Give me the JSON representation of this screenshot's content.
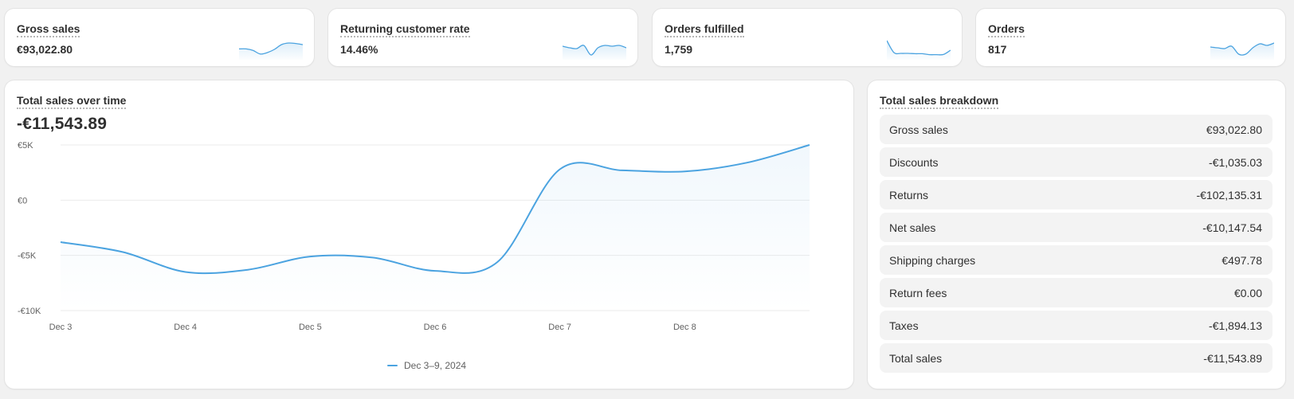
{
  "metrics": [
    {
      "title": "Gross sales",
      "value": "€93,022.80",
      "spark": [
        0.52,
        0.52,
        0.62,
        0.84,
        0.75,
        0.55,
        0.25,
        0.15,
        0.18,
        0.25
      ]
    },
    {
      "title": "Returning customer rate",
      "value": "14.46%",
      "spark": [
        0.35,
        0.45,
        0.5,
        0.3,
        0.9,
        0.45,
        0.3,
        0.35,
        0.3,
        0.45
      ]
    },
    {
      "title": "Orders fulfilled",
      "value": "1,759",
      "spark": [
        0.0,
        0.75,
        0.8,
        0.8,
        0.82,
        0.82,
        0.88,
        0.88,
        0.87,
        0.6
      ]
    },
    {
      "title": "Orders",
      "value": "817",
      "spark": [
        0.4,
        0.45,
        0.5,
        0.35,
        0.85,
        0.85,
        0.45,
        0.2,
        0.3,
        0.15
      ]
    }
  ],
  "chart": {
    "title": "Total sales over time",
    "total": "-€11,543.89",
    "legend": "Dec 3–9, 2024"
  },
  "chart_data": {
    "type": "area",
    "title": "Total sales over time",
    "x": [
      "Dec 3",
      "Dec 3 12:00",
      "Dec 4",
      "Dec 4 12:00",
      "Dec 5",
      "Dec 5 12:00",
      "Dec 6",
      "Dec 6 12:00",
      "Dec 7",
      "Dec 7 12:00",
      "Dec 8",
      "Dec 8 12:00",
      "Dec 9"
    ],
    "x_tick_labels": [
      "Dec 3",
      "Dec 4",
      "Dec 5",
      "Dec 6",
      "Dec 7",
      "Dec 8"
    ],
    "series": [
      {
        "name": "Dec 3–9, 2024",
        "values": [
          -3800,
          -4700,
          -6500,
          -6300,
          -5100,
          -5200,
          -6400,
          -5600,
          2800,
          2700,
          2600,
          3400,
          5000
        ]
      }
    ],
    "y_tick_labels": [
      "€5K",
      "€0",
      "-€5K",
      "-€10K"
    ],
    "y_tick_values": [
      5000,
      0,
      -5000,
      -10000
    ],
    "ylim": [
      -10000,
      5000
    ],
    "grid": true,
    "legend_position": "bottom-center",
    "color": "#4ba3e0"
  },
  "breakdown": {
    "title": "Total sales breakdown",
    "rows": [
      {
        "label": "Gross sales",
        "value": "€93,022.80"
      },
      {
        "label": "Discounts",
        "value": "-€1,035.03"
      },
      {
        "label": "Returns",
        "value": "-€102,135.31"
      },
      {
        "label": "Net sales",
        "value": "-€10,147.54"
      },
      {
        "label": "Shipping charges",
        "value": "€497.78"
      },
      {
        "label": "Return fees",
        "value": "€0.00"
      },
      {
        "label": "Taxes",
        "value": "-€1,894.13"
      },
      {
        "label": "Total sales",
        "value": "-€11,543.89"
      }
    ]
  },
  "colors": {
    "accent": "#4ba3e0",
    "background": "#f1f1f1",
    "card": "#ffffff",
    "row": "#f3f3f3"
  }
}
